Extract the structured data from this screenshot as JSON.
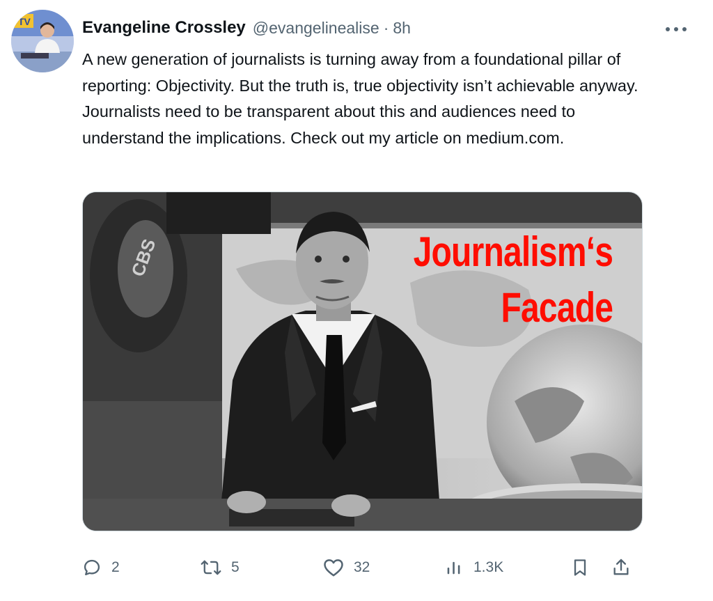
{
  "author": {
    "name": "Evangeline Crossley",
    "handle": "@evangelinealise",
    "separator": "·",
    "time": "8h",
    "avatar_badge": "TV"
  },
  "tweet": {
    "text": "A new generation of journalists is turning away from a foundational pillar of reporting: Objectivity. But the truth is, true objectivity isn’t achievable anyway. Journalists need to be transparent about this and audiences need to understand the implications. Check out my article on medium.com."
  },
  "media": {
    "overlay_line1": "Journalism‘s",
    "overlay_line2": "Facade",
    "overlay_color": "#ff0d00",
    "photo_style": "black-and-white newsroom photo of an anchor at a desk beside a globe"
  },
  "actions": {
    "reply_icon": "reply-icon",
    "reply_count": "2",
    "retweet_icon": "retweet-icon",
    "retweet_count": "5",
    "like_icon": "heart-icon",
    "like_count": "32",
    "views_icon": "views-icon",
    "views_count": "1.3K",
    "bookmark_icon": "bookmark-icon",
    "share_icon": "share-icon"
  },
  "colors": {
    "text_primary": "#0f1419",
    "text_secondary": "#536471",
    "accent_red": "#ff0d00"
  }
}
